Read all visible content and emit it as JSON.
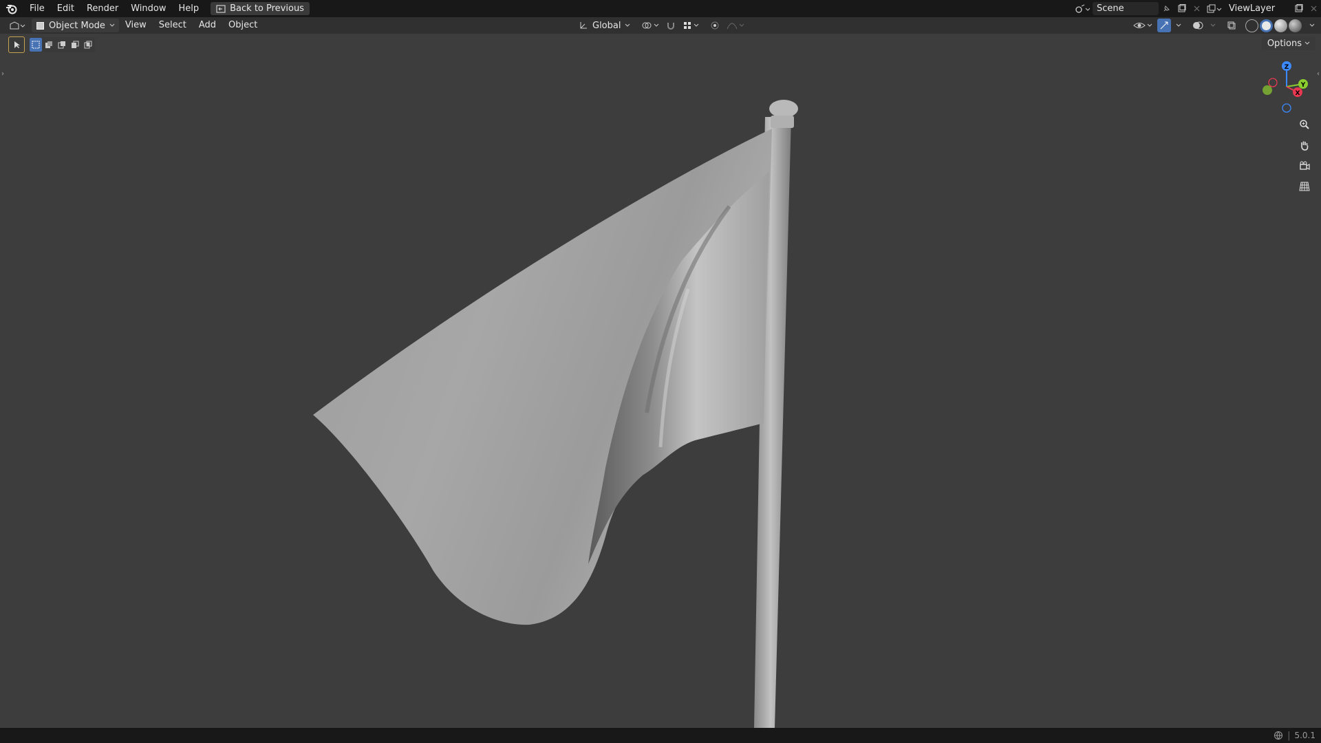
{
  "topbar": {
    "menus": [
      "File",
      "Edit",
      "Render",
      "Window",
      "Help"
    ],
    "back_label": "Back to Previous",
    "scene": "Scene",
    "view_layer": "ViewLayer"
  },
  "header": {
    "mode": "Object Mode",
    "menus": [
      "View",
      "Select",
      "Add",
      "Object"
    ],
    "orientation": "Global"
  },
  "viewport": {
    "options_label": "Options",
    "gizmo": {
      "z": "Z",
      "y": "Y",
      "x": "X"
    },
    "object": "flag-on-pole"
  },
  "status": {
    "version": "5.0.1"
  },
  "colors": {
    "accent": "#4772b3",
    "axis_x": "#e8384f",
    "axis_y": "#8bcd2f",
    "axis_z": "#3c8aff"
  }
}
